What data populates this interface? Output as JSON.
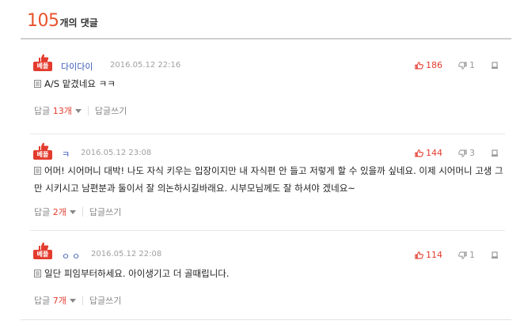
{
  "header": {
    "count": "105",
    "label": "개의 댓글"
  },
  "badge_label": "베플",
  "comments": [
    {
      "author": "다이다이",
      "date": "2016.05.12 22:16",
      "likes": "186",
      "dislikes": "1",
      "body": "A/S 맡겼네요 ㅋㅋ",
      "reply_label": "답글",
      "reply_count": "13개",
      "write_reply": "답글쓰기"
    },
    {
      "author": "ㅋ",
      "date": "2016.05.12 23:08",
      "likes": "144",
      "dislikes": "3",
      "body": "어머! 시어머니 대박! 나도 자식 키우는 입장이지만 내 자식편 안 들고 저렇게 할 수 있을까 싶네요. 이제 시어머니 고생 그만 시키시고 남편분과 둘이서 잘 의논하시길바래요. 시부모님께도 잘 하셔야 겠네요~",
      "reply_label": "답글",
      "reply_count": "2개",
      "write_reply": "답글쓰기"
    },
    {
      "author": "ㅇㅇ",
      "date": "2016.05.12 22:08",
      "likes": "114",
      "dislikes": "1",
      "body": "일단 피임부터하세요. 아이생기고 더 골때립니다.",
      "reply_label": "답글",
      "reply_count": "7개",
      "write_reply": "답글쓰기"
    }
  ],
  "colors": {
    "accent": "#e8532e",
    "badge": "#e33b2e",
    "author": "#3b5bb5"
  }
}
